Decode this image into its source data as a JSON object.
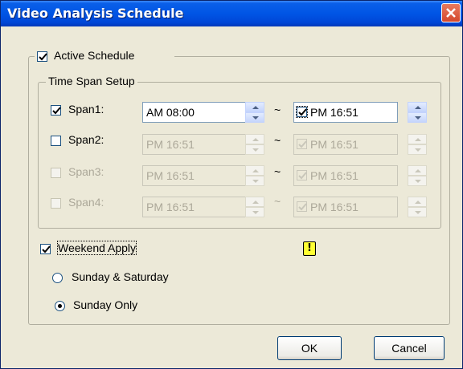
{
  "window": {
    "title": "Video Analysis Schedule"
  },
  "active_schedule": {
    "label": "Active Schedule",
    "checked": true
  },
  "time_span_setup": {
    "legend": "Time Span Setup",
    "spans": [
      {
        "label": "Span1:",
        "checked": true,
        "enabled": true,
        "start": "AM 08:00",
        "end": "PM 16:51",
        "end_checked": true
      },
      {
        "label": "Span2:",
        "checked": false,
        "enabled": true,
        "start": "PM 16:51",
        "end": "PM 16:51",
        "end_checked": true
      },
      {
        "label": "Span3:",
        "checked": false,
        "enabled": false,
        "start": "PM 16:51",
        "end": "PM 16:51",
        "end_checked": true
      },
      {
        "label": "Span4:",
        "checked": false,
        "enabled": false,
        "start": "PM 16:51",
        "end": "PM 16:51",
        "end_checked": true
      }
    ],
    "separator": "~"
  },
  "weekend": {
    "label": "Weekend Apply",
    "checked": true,
    "options": [
      {
        "label": "Sunday & Saturday",
        "selected": false
      },
      {
        "label": "Sunday Only",
        "selected": true
      }
    ]
  },
  "warning_icon": "!",
  "buttons": {
    "ok": "OK",
    "cancel": "Cancel"
  }
}
